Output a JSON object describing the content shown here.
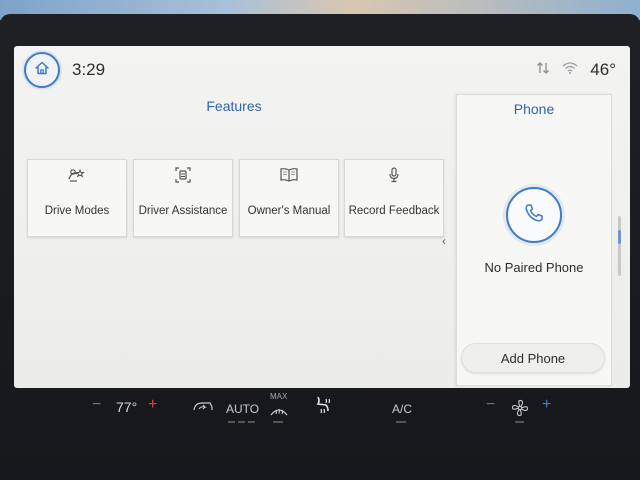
{
  "status_bar": {
    "time": "3:29",
    "outside_temp": "46°",
    "icons": [
      "home-icon",
      "data-sync-icon",
      "wifi-icon"
    ]
  },
  "features": {
    "title": "Features",
    "tiles": [
      {
        "label": "Drive Modes",
        "icon": "drive-modes-icon"
      },
      {
        "label": "Driver Assistance",
        "icon": "driver-assistance-icon"
      },
      {
        "label": "Owner's Manual",
        "icon": "book-icon"
      },
      {
        "label": "Record Feedback",
        "icon": "microphone-icon"
      }
    ],
    "collapse_glyph": "‹"
  },
  "phone": {
    "title": "Phone",
    "status": "No Paired Phone",
    "add_button": "Add Phone",
    "icon": "phone-icon"
  },
  "climate": {
    "driver_temp": "77°",
    "auto_label": "AUTO",
    "max_label": "MAX",
    "ac_label": "A/C",
    "minus": "−",
    "plus": "+"
  },
  "colors": {
    "accent": "#3f7bc7",
    "title_blue": "#2f66ad",
    "temp_up": "#d8434b",
    "temp_down": "#3d7fd6"
  }
}
